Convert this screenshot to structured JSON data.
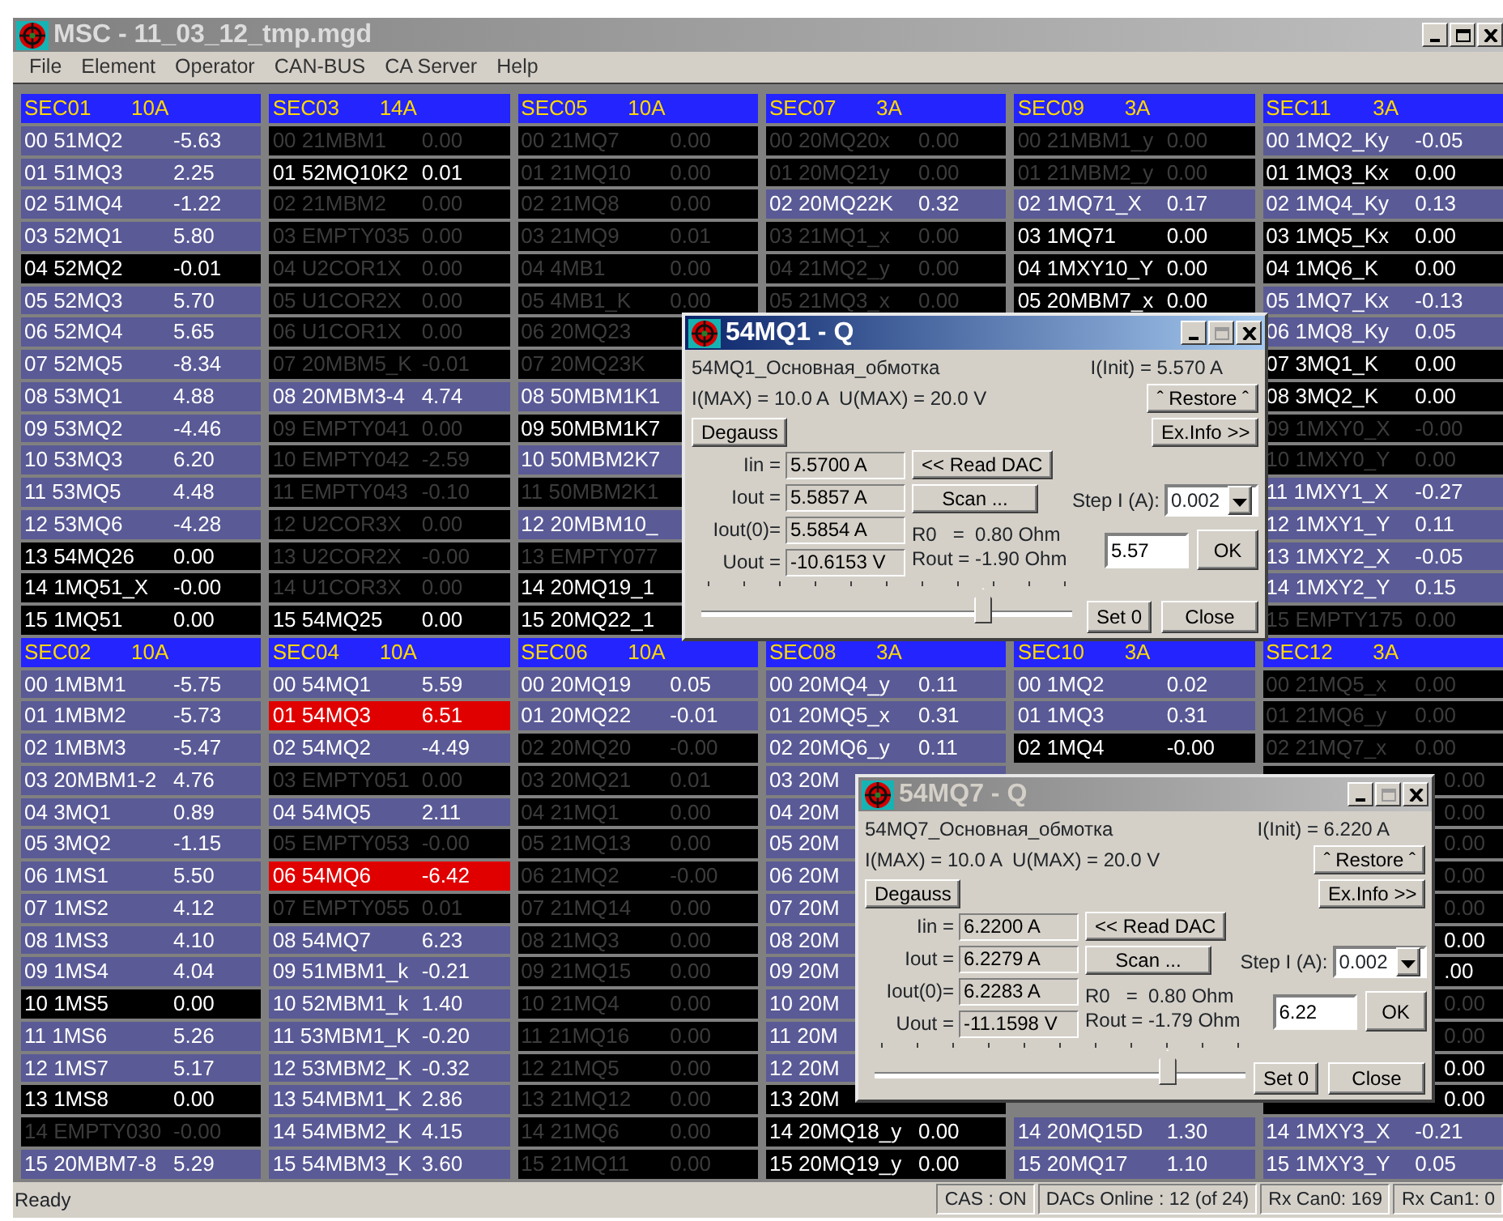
{
  "window": {
    "title": "MSC - 11_03_12_tmp.mgd"
  },
  "menu": [
    "File",
    "Element",
    "Operator",
    "CAN-BUS",
    "CA Server",
    "Help"
  ],
  "sections_top": [
    {
      "name": "SEC01",
      "current": "10A",
      "channels": [
        {
          "text": "00 51MQ2",
          "value": "-5.63",
          "kind": "on"
        },
        {
          "text": "01 51MQ3",
          "value": "2.25",
          "kind": "on"
        },
        {
          "text": "02 51MQ4",
          "value": "-1.22",
          "kind": "on"
        },
        {
          "text": "03 52MQ1",
          "value": "5.80",
          "kind": "on"
        },
        {
          "text": "04 52MQ2",
          "value": "-0.01",
          "kind": "zero"
        },
        {
          "text": "05 52MQ3",
          "value": "5.70",
          "kind": "on"
        },
        {
          "text": "06 52MQ4",
          "value": "5.65",
          "kind": "on"
        },
        {
          "text": "07 52MQ5",
          "value": "-8.34",
          "kind": "on"
        },
        {
          "text": "08 53MQ1",
          "value": "4.88",
          "kind": "on"
        },
        {
          "text": "09 53MQ2",
          "value": "-4.46",
          "kind": "on"
        },
        {
          "text": "10 53MQ3",
          "value": "6.20",
          "kind": "on"
        },
        {
          "text": "11 53MQ5",
          "value": "4.48",
          "kind": "on"
        },
        {
          "text": "12 53MQ6",
          "value": "-4.28",
          "kind": "on"
        },
        {
          "text": "13 54MQ26",
          "value": "0.00",
          "kind": "zero"
        },
        {
          "text": "14 1MQ51_X",
          "value": "-0.00",
          "kind": "zero"
        },
        {
          "text": "15 1MQ51",
          "value": "0.00",
          "kind": "zero"
        }
      ]
    },
    {
      "name": "SEC03",
      "current": "14A",
      "channels": [
        {
          "text": "00 21MBM1",
          "value": "0.00",
          "kind": "off"
        },
        {
          "text": "01 52MQ10K2",
          "value": "0.01",
          "kind": "zero"
        },
        {
          "text": "02 21MBM2",
          "value": "0.00",
          "kind": "off"
        },
        {
          "text": "03 EMPTY035",
          "value": "0.00",
          "kind": "off"
        },
        {
          "text": "04 U2COR1X",
          "value": "0.00",
          "kind": "off"
        },
        {
          "text": "05 U1COR2X",
          "value": "0.00",
          "kind": "off"
        },
        {
          "text": "06 U1COR1X",
          "value": "0.00",
          "kind": "off"
        },
        {
          "text": "07 20MBM5_K",
          "value": "-0.01",
          "kind": "off"
        },
        {
          "text": "08 20MBM3-4",
          "value": "4.74",
          "kind": "on"
        },
        {
          "text": "09 EMPTY041",
          "value": "0.00",
          "kind": "off"
        },
        {
          "text": "10 EMPTY042",
          "value": "-2.59",
          "kind": "off"
        },
        {
          "text": "11 EMPTY043",
          "value": "-0.10",
          "kind": "off"
        },
        {
          "text": "12 U2COR3X",
          "value": "0.00",
          "kind": "off"
        },
        {
          "text": "13 U2COR2X",
          "value": "-0.00",
          "kind": "off"
        },
        {
          "text": "14 U1COR3X",
          "value": "0.00",
          "kind": "off"
        },
        {
          "text": "15 54MQ25",
          "value": "0.00",
          "kind": "zero"
        }
      ]
    },
    {
      "name": "SEC05",
      "current": "10A",
      "channels": [
        {
          "text": "00 21MQ7",
          "value": "0.00",
          "kind": "off"
        },
        {
          "text": "01 21MQ10",
          "value": "0.00",
          "kind": "off"
        },
        {
          "text": "02 21MQ8",
          "value": "0.00",
          "kind": "off"
        },
        {
          "text": "03 21MQ9",
          "value": "0.01",
          "kind": "off"
        },
        {
          "text": "04 4MB1",
          "value": "0.00",
          "kind": "off"
        },
        {
          "text": "05 4MB1_K",
          "value": "0.00",
          "kind": "off"
        },
        {
          "text": "06 20MQ23",
          "kind": "off"
        },
        {
          "text": "07 20MQ23K",
          "kind": "off"
        },
        {
          "text": "08 50MBM1K1",
          "kind": "on"
        },
        {
          "text": "09 50MBM1K7",
          "kind": "zero"
        },
        {
          "text": "10 50MBM2K7",
          "kind": "on"
        },
        {
          "text": "11 50MBM2K1",
          "kind": "off"
        },
        {
          "text": "12 20MBM10_",
          "kind": "on"
        },
        {
          "text": "13 EMPTY077",
          "kind": "off"
        },
        {
          "text": "14 20MQ19_1",
          "kind": "zero"
        },
        {
          "text": "15 20MQ22_1",
          "kind": "zero"
        }
      ]
    },
    {
      "name": "SEC07",
      "current": "3A",
      "channels": [
        {
          "text": "00 20MQ20x",
          "value": "0.00",
          "kind": "off"
        },
        {
          "text": "01 20MQ21y",
          "value": "0.00",
          "kind": "off"
        },
        {
          "text": "02 20MQ22K",
          "value": "0.32",
          "kind": "on"
        },
        {
          "text": "03 21MQ1_x",
          "value": "0.00",
          "kind": "off"
        },
        {
          "text": "04 21MQ2_y",
          "value": "0.00",
          "kind": "off"
        },
        {
          "text": "05 21MQ3_x",
          "value": "0.00",
          "kind": "off"
        }
      ]
    },
    {
      "name": "SEC09",
      "current": "3A",
      "channels": [
        {
          "text": "00 21MBM1_y",
          "value": "0.00",
          "kind": "off"
        },
        {
          "text": "01 21MBM2_y",
          "value": "0.00",
          "kind": "off"
        },
        {
          "text": "02 1MQ71_X",
          "value": "0.17",
          "kind": "on"
        },
        {
          "text": "03 1MQ71",
          "value": "0.00",
          "kind": "zero"
        },
        {
          "text": "04 1MXY10_Y",
          "value": "0.00",
          "kind": "zero"
        },
        {
          "text": "05 20MBM7_x",
          "value": "0.00",
          "kind": "zero"
        }
      ]
    },
    {
      "name": "SEC11",
      "current": "3A",
      "channels": [
        {
          "text": "00 1MQ2_Ky",
          "value": "-0.05",
          "kind": "on"
        },
        {
          "text": "01 1MQ3_Kx",
          "value": "0.00",
          "kind": "zero"
        },
        {
          "text": "02 1MQ4_Ky",
          "value": "0.13",
          "kind": "on"
        },
        {
          "text": "03 1MQ5_Kx",
          "value": "0.00",
          "kind": "zero"
        },
        {
          "text": "04 1MQ6_K",
          "value": "0.00",
          "kind": "zero"
        },
        {
          "text": "05 1MQ7_Kx",
          "value": "-0.13",
          "kind": "on"
        },
        {
          "text": "06 1MQ8_Ky",
          "value": "0.05",
          "kind": "on"
        },
        {
          "text": "07 3MQ1_K",
          "value": "0.00",
          "kind": "zero"
        },
        {
          "text": "08 3MQ2_K",
          "value": "0.00",
          "kind": "zero"
        },
        {
          "text": "09 1MXY0_X",
          "value": "-0.00",
          "kind": "off"
        },
        {
          "text": "10 1MXY0_Y",
          "value": "0.00",
          "kind": "off"
        },
        {
          "text": "11 1MXY1_X",
          "value": "-0.27",
          "kind": "on"
        },
        {
          "text": "12 1MXY1_Y",
          "value": "0.11",
          "kind": "on"
        },
        {
          "text": "13 1MXY2_X",
          "value": "-0.05",
          "kind": "on"
        },
        {
          "text": "14 1MXY2_Y",
          "value": "0.15",
          "kind": "on"
        },
        {
          "text": "15 EMPTY175",
          "value": "0.00",
          "kind": "off"
        }
      ]
    }
  ],
  "sections_bottom": [
    {
      "name": "SEC02",
      "current": "10A",
      "channels": [
        {
          "text": "00 1MBM1",
          "value": "-5.75",
          "kind": "on"
        },
        {
          "text": "01 1MBM2",
          "value": "-5.73",
          "kind": "on"
        },
        {
          "text": "02 1MBM3",
          "value": "-5.47",
          "kind": "on"
        },
        {
          "text": "03 20MBM1-2",
          "value": "4.76",
          "kind": "on"
        },
        {
          "text": "04 3MQ1",
          "value": "0.89",
          "kind": "on"
        },
        {
          "text": "05 3MQ2",
          "value": "-1.15",
          "kind": "on"
        },
        {
          "text": "06 1MS1",
          "value": "5.50",
          "kind": "on"
        },
        {
          "text": "07 1MS2",
          "value": "4.12",
          "kind": "on"
        },
        {
          "text": "08 1MS3",
          "value": "4.10",
          "kind": "on"
        },
        {
          "text": "09 1MS4",
          "value": "4.04",
          "kind": "on"
        },
        {
          "text": "10 1MS5",
          "value": "0.00",
          "kind": "zero"
        },
        {
          "text": "11 1MS6",
          "value": "5.26",
          "kind": "on"
        },
        {
          "text": "12 1MS7",
          "value": "5.17",
          "kind": "on"
        },
        {
          "text": "13 1MS8",
          "value": "0.00",
          "kind": "zero"
        },
        {
          "text": "14 EMPTY030",
          "value": "-0.00",
          "kind": "off"
        },
        {
          "text": "15 20MBM7-8",
          "value": "5.29",
          "kind": "on"
        }
      ]
    },
    {
      "name": "SEC04",
      "current": "10A",
      "channels": [
        {
          "text": "00 54MQ1",
          "value": "5.59",
          "kind": "on"
        },
        {
          "text": "01 54MQ3",
          "value": "6.51",
          "kind": "alarm"
        },
        {
          "text": "02 54MQ2",
          "value": "-4.49",
          "kind": "on"
        },
        {
          "text": "03 EMPTY051",
          "value": "0.00",
          "kind": "off"
        },
        {
          "text": "04 54MQ5",
          "value": "2.11",
          "kind": "on"
        },
        {
          "text": "05 EMPTY053",
          "value": "-0.00",
          "kind": "off"
        },
        {
          "text": "06 54MQ6",
          "value": "-6.42",
          "kind": "alarm"
        },
        {
          "text": "07 EMPTY055",
          "value": "0.01",
          "kind": "off"
        },
        {
          "text": "08 54MQ7",
          "value": "6.23",
          "kind": "on"
        },
        {
          "text": "09 51MBM1_k",
          "value": "-0.21",
          "kind": "on"
        },
        {
          "text": "10 52MBM1_k",
          "value": "1.40",
          "kind": "on"
        },
        {
          "text": "11 53MBM1_K",
          "value": "-0.20",
          "kind": "on"
        },
        {
          "text": "12 53MBM2_K",
          "value": "-0.32",
          "kind": "on"
        },
        {
          "text": "13 54MBM1_K",
          "value": "2.86",
          "kind": "on"
        },
        {
          "text": "14 54MBM2_K",
          "value": "4.15",
          "kind": "on"
        },
        {
          "text": "15 54MBM3_K",
          "value": "3.60",
          "kind": "on"
        }
      ]
    },
    {
      "name": "SEC06",
      "current": "10A",
      "channels": [
        {
          "text": "00 20MQ19",
          "value": "0.05",
          "kind": "on"
        },
        {
          "text": "01 20MQ22",
          "value": "-0.01",
          "kind": "on"
        },
        {
          "text": "02 20MQ20",
          "value": "-0.00",
          "kind": "off"
        },
        {
          "text": "03 20MQ21",
          "value": "0.01",
          "kind": "off"
        },
        {
          "text": "04 21MQ1",
          "value": "0.00",
          "kind": "off"
        },
        {
          "text": "05 21MQ13",
          "value": "0.00",
          "kind": "off"
        },
        {
          "text": "06 21MQ2",
          "value": "-0.00",
          "kind": "off"
        },
        {
          "text": "07 21MQ14",
          "value": "0.00",
          "kind": "off"
        },
        {
          "text": "08 21MQ3",
          "value": "0.00",
          "kind": "off"
        },
        {
          "text": "09 21MQ15",
          "value": "0.00",
          "kind": "off"
        },
        {
          "text": "10 21MQ4",
          "value": "0.00",
          "kind": "off"
        },
        {
          "text": "11 21MQ16",
          "value": "0.00",
          "kind": "off"
        },
        {
          "text": "12 21MQ5",
          "value": "0.00",
          "kind": "off"
        },
        {
          "text": "13 21MQ12",
          "value": "0.00",
          "kind": "off"
        },
        {
          "text": "14 21MQ6",
          "value": "0.00",
          "kind": "off"
        },
        {
          "text": "15 21MQ11",
          "value": "0.00",
          "kind": "off"
        }
      ]
    },
    {
      "name": "SEC08",
      "current": "3A",
      "channels": [
        {
          "text": "00 20MQ4_y",
          "value": "0.11",
          "kind": "on"
        },
        {
          "text": "01 20MQ5_x",
          "value": "0.31",
          "kind": "on"
        },
        {
          "text": "02 20MQ6_y",
          "value": "0.11",
          "kind": "on"
        },
        {
          "text": "03 20M",
          "kind": "on"
        },
        {
          "text": "04 20M",
          "kind": "on"
        },
        {
          "text": "05 20M",
          "kind": "on"
        },
        {
          "text": "06 20M",
          "kind": "on"
        },
        {
          "text": "07 20M",
          "kind": "on"
        },
        {
          "text": "08 20M",
          "kind": "on"
        },
        {
          "text": "09 20M",
          "kind": "on"
        },
        {
          "text": "10 20M",
          "kind": "on"
        },
        {
          "text": "11 20M",
          "kind": "on"
        },
        {
          "text": "12 20M",
          "kind": "on"
        },
        {
          "text": "13 20M",
          "kind": "zero"
        },
        {
          "text": "14 20MQ18_y",
          "value": "0.00",
          "kind": "zero"
        },
        {
          "text": "15 20MQ19_y",
          "value": "0.00",
          "kind": "zero"
        }
      ]
    },
    {
      "name": "SEC10",
      "current": "3A",
      "channels": [
        {
          "text": "00 1MQ2",
          "value": "0.02",
          "kind": "on"
        },
        {
          "text": "01 1MQ3",
          "value": "0.31",
          "kind": "on"
        },
        {
          "text": "02 1MQ4",
          "value": "-0.00",
          "kind": "zero"
        }
      ],
      "lower_channels": [
        {
          "text": "14 20MQ15D",
          "value": "1.30",
          "kind": "on"
        },
        {
          "text": "15 20MQ17",
          "value": "1.10",
          "kind": "on"
        }
      ]
    },
    {
      "name": "SEC12",
      "current": "3A",
      "channels": [
        {
          "text": "00 21MQ5_x",
          "value": "0.00",
          "kind": "off"
        },
        {
          "text": "01 21MQ6_y",
          "value": "0.00",
          "kind": "off"
        },
        {
          "text": "02 21MQ7_x",
          "value": "0.00",
          "kind": "off"
        },
        {
          "value": "0.00",
          "kind": "off"
        },
        {
          "value": "0.00",
          "kind": "off"
        },
        {
          "value": "0.00",
          "kind": "off"
        },
        {
          "value": "0.00",
          "kind": "off"
        },
        {
          "value": "0.00",
          "kind": "off"
        },
        {
          "value": "0.00",
          "kind": "zero"
        },
        {
          "value": ".00",
          "kind": "zero"
        },
        {
          "value": "0.00",
          "kind": "off"
        },
        {
          "value": "0.00",
          "kind": "off"
        },
        {
          "value": "0.00",
          "kind": "zero"
        },
        {
          "value": "0.00",
          "kind": "zero"
        },
        {
          "text": "14 1MXY3_X",
          "value": "-0.21",
          "kind": "on"
        },
        {
          "text": "15 1MXY3_Y",
          "value": "0.05",
          "kind": "on"
        }
      ]
    }
  ],
  "dialogs": [
    {
      "title": "54MQ1 - Q",
      "active": true,
      "description": "54MQ1_Основная_обмотка",
      "init": "I(Init) = 5.570 A",
      "limits": "I(MAX) = 10.0 A  U(MAX) = 20.0 V",
      "restore": "ˆ Restore ˆ",
      "degauss": "Degauss",
      "info": "Ex.Info >>",
      "readings": [
        {
          "label": "Iin =",
          "value": "5.5700 A"
        },
        {
          "label": "Iout =",
          "value": "5.5857 A"
        },
        {
          "label": "Iout(0)=",
          "value": "5.5854 A"
        },
        {
          "label": "Uout =",
          "value": "-10.6153 V"
        }
      ],
      "read": "<< Read DAC",
      "scan": "Scan ...",
      "r0": "R0   =  0.80 Ohm",
      "rout": "Rout = -1.90 Ohm",
      "step_label": "Step I (A):",
      "step": "0.002",
      "setpoint": "5.57",
      "ok": "OK",
      "set0": "Set 0",
      "close": "Close",
      "slider": {
        "level": 0.76
      }
    },
    {
      "title": "54MQ7 - Q",
      "active": false,
      "description": "54MQ7_Основная_обмотка",
      "init": "I(Init) = 6.220 A",
      "limits": "I(MAX) = 10.0 A  U(MAX) = 20.0 V",
      "restore": "ˆ Restore ˆ",
      "degauss": "Degauss",
      "info": "Ex.Info >>",
      "readings": [
        {
          "label": "Iin =",
          "value": "6.2200 A"
        },
        {
          "label": "Iout =",
          "value": "6.2279 A"
        },
        {
          "label": "Iout(0)=",
          "value": "6.2283 A"
        },
        {
          "label": "Uout =",
          "value": "-11.1598 V"
        }
      ],
      "read": "<< Read DAC",
      "scan": "Scan ...",
      "r0": "R0   =  0.80 Ohm",
      "rout": "Rout = -1.79 Ohm",
      "step_label": "Step I (A):",
      "step": "0.002",
      "setpoint": "6.22",
      "ok": "OK",
      "set0": "Set 0",
      "close": "Close",
      "slider": {
        "level": 0.79
      }
    }
  ],
  "status_bar": {
    "message": "Ready",
    "panels": [
      "CAS : ON",
      "DACs Online : 12 (of 24)",
      "Rx Can0: 169",
      "Rx Can1: 0"
    ]
  }
}
